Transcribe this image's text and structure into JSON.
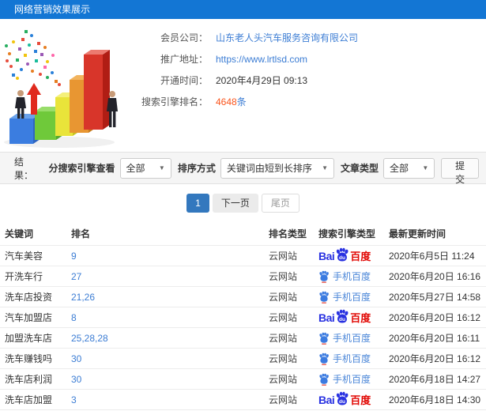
{
  "window": {
    "title": "网络营销效果展示"
  },
  "info": {
    "member_label": "会员公司：",
    "member_value": "山东老人头汽车服务咨询有限公司",
    "url_label": "推广地址：",
    "url_value": "https://www.lrtlsd.com",
    "open_label": "开通时间：",
    "open_value": "2020年4月29日 09:13",
    "rank_label": "搜索引擎排名：",
    "rank_count": "4648",
    "rank_unit": "条"
  },
  "filters": {
    "result_label": "结果：",
    "engine_label": "分搜索引擎查看",
    "engine_value": "全部",
    "sort_label": "排序方式",
    "sort_value": "关键词由短到长排序",
    "article_label": "文章类型",
    "article_value": "全部",
    "submit_label": "提交"
  },
  "pagination": {
    "current": "1",
    "next": "下一页",
    "last": "尾页"
  },
  "table": {
    "headers": [
      "关键词",
      "排名",
      "排名类型",
      "搜索引擎类型",
      "最新更新时间"
    ],
    "rows": [
      {
        "keyword": "汽车美容",
        "rank": "9",
        "rank_type": "云网站",
        "engine": "百度",
        "time": "2020年6月5日 11:24"
      },
      {
        "keyword": "开洗车行",
        "rank": "27",
        "rank_type": "云网站",
        "engine": "手机百度",
        "time": "2020年6月20日 16:16"
      },
      {
        "keyword": "洗车店投资",
        "rank": "21,26",
        "rank_type": "云网站",
        "engine": "手机百度",
        "time": "2020年5月27日 14:58"
      },
      {
        "keyword": "汽车加盟店",
        "rank": "8",
        "rank_type": "云网站",
        "engine": "百度",
        "time": "2020年6月20日 16:12"
      },
      {
        "keyword": "加盟洗车店",
        "rank": "25,28,28",
        "rank_type": "云网站",
        "engine": "手机百度",
        "time": "2020年6月20日 16:11"
      },
      {
        "keyword": "洗车赚钱吗",
        "rank": "30",
        "rank_type": "云网站",
        "engine": "手机百度",
        "time": "2020年6月20日 16:12"
      },
      {
        "keyword": "洗车店利润",
        "rank": "30",
        "rank_type": "云网站",
        "engine": "手机百度",
        "time": "2020年6月18日 14:27"
      },
      {
        "keyword": "洗车店加盟",
        "rank": "3",
        "rank_type": "云网站",
        "engine": "百度",
        "time": "2020年6月18日 14:30"
      }
    ]
  },
  "baidu": {
    "bai": "Bai",
    "du": "du",
    "cn": "百度",
    "mobile_label": "手机百度"
  },
  "colors": {
    "header_bg": "#1376d4",
    "link": "#3c7dd4",
    "rank_highlight": "#fa541c",
    "baidu_blue": "#2932e1",
    "baidu_red": "#e10602",
    "page_active": "#3378be",
    "filter_bg": "#f5f5f5"
  }
}
